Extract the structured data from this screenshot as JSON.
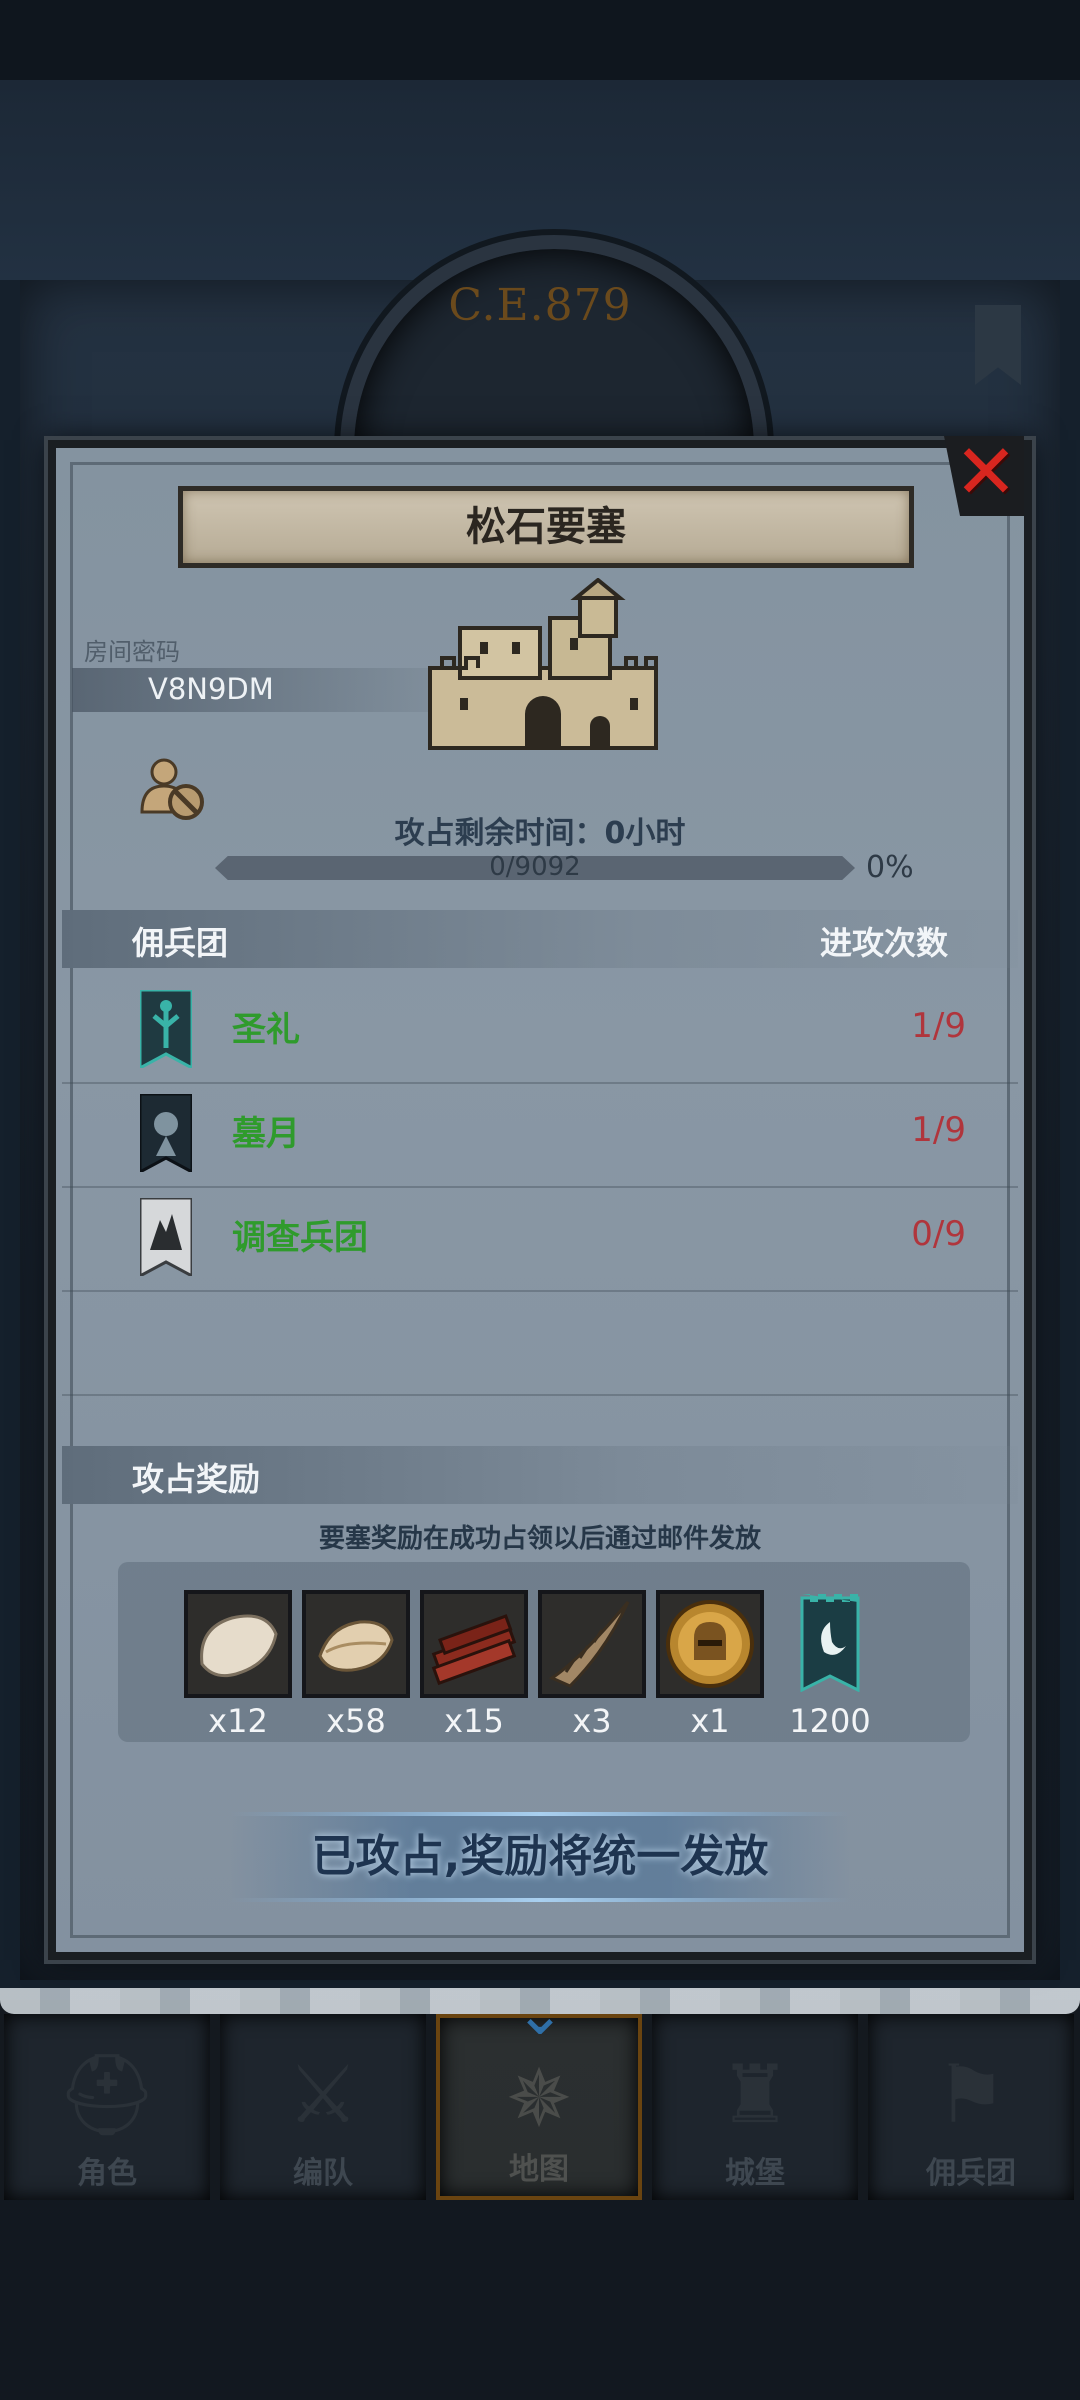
{
  "header": {
    "era": "C.E.879"
  },
  "modal": {
    "title": "松石要塞",
    "room_label": "房间密码",
    "room_code": "V8N9DM",
    "siege_time": "攻占剩余时间：0小时",
    "progress": {
      "text": "0/9092",
      "percent_label": "0%",
      "fraction": 0
    },
    "mercenary_header": "佣兵团",
    "attack_header": "进攻次数",
    "guilds": [
      {
        "name": "圣礼",
        "count": "1/9",
        "flag_color": "#39b3a8"
      },
      {
        "name": "墓月",
        "count": "1/9",
        "flag_color": "#1d2a33"
      },
      {
        "name": "调查兵团",
        "count": "0/9",
        "flag_color": "#d6d8da"
      }
    ],
    "reward_header": "攻占奖励",
    "reward_note": "要塞奖励在成功占领以后通过邮件发放",
    "rewards": [
      {
        "icon": "fur-pelt-icon",
        "count": "x12"
      },
      {
        "icon": "leather-hide-icon",
        "count": "x58"
      },
      {
        "icon": "wood-planks-icon",
        "count": "x15"
      },
      {
        "icon": "horn-icon",
        "count": "x3"
      },
      {
        "icon": "knight-medal-icon",
        "count": "x1"
      },
      {
        "icon": "guild-banner-icon",
        "count": "1200"
      }
    ],
    "status_button": "已攻占,奖励将统一发放"
  },
  "nav": {
    "tabs": [
      {
        "label": "角色",
        "icon": "knight-helmet-icon"
      },
      {
        "label": "编队",
        "icon": "formation-icon"
      },
      {
        "label": "地图",
        "icon": "map-compass-icon",
        "active": true
      },
      {
        "label": "城堡",
        "icon": "castle-icon"
      },
      {
        "label": "佣兵团",
        "icon": "mercenary-icon"
      }
    ]
  }
}
